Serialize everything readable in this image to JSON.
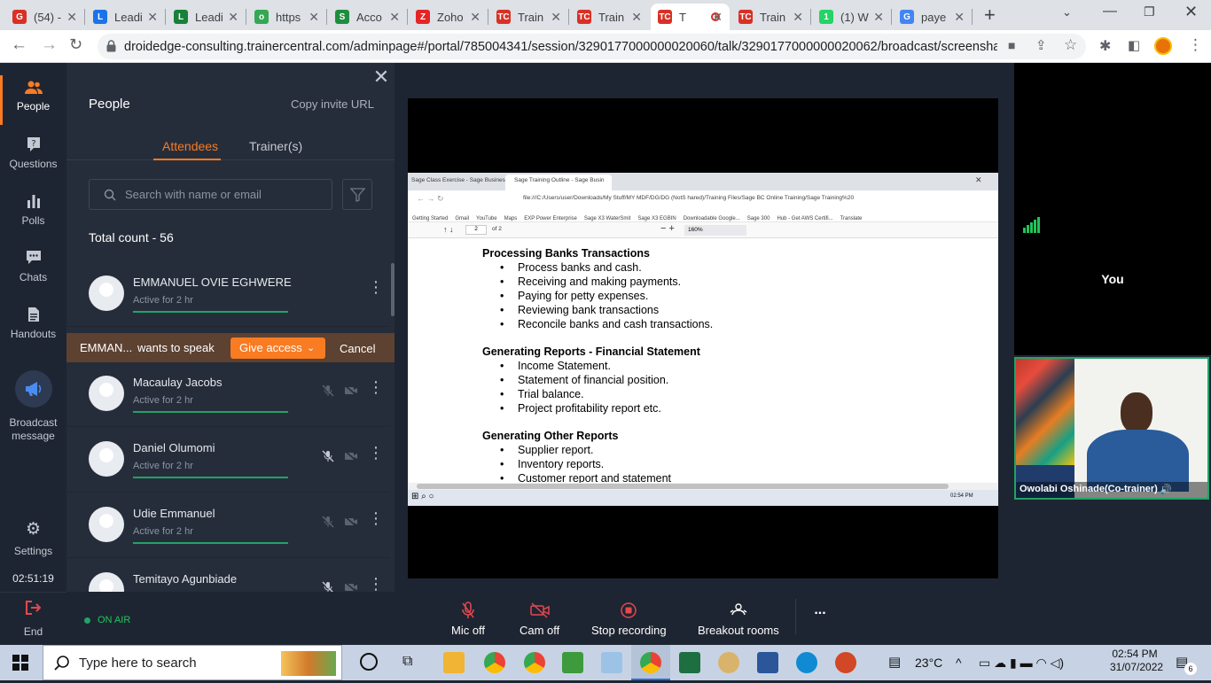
{
  "browser": {
    "tabs": [
      {
        "label": "(54) -",
        "color": "#d93025",
        "glyph": "G"
      },
      {
        "label": "Leadi",
        "color": "#1a73e8",
        "glyph": "L"
      },
      {
        "label": "Leadi",
        "color": "#188038",
        "glyph": "L"
      },
      {
        "label": "https",
        "color": "#34a853",
        "glyph": "o"
      },
      {
        "label": "Acco",
        "color": "#1e8e3e",
        "glyph": "S"
      },
      {
        "label": "Zoho",
        "color": "#e42527",
        "glyph": "Z"
      },
      {
        "label": "Train",
        "color": "#d93025",
        "glyph": "TC"
      },
      {
        "label": "Train",
        "color": "#d93025",
        "glyph": "TC"
      },
      {
        "label": "T",
        "color": "#d93025",
        "glyph": "TC"
      },
      {
        "label": "Train",
        "color": "#d93025",
        "glyph": "TC"
      },
      {
        "label": "(1) W",
        "color": "#25d366",
        "glyph": "1"
      },
      {
        "label": "paye",
        "color": "#4285f4",
        "glyph": "G"
      }
    ],
    "new_tab": "+",
    "url": "droidedge-consulting.trainercentral.com/adminpage#/portal/785004341/session/3290177000000020060/talk/3290177000000020062/broadcast/screenshare..."
  },
  "rail": {
    "items": [
      {
        "label": "People",
        "icon": "people-icon"
      },
      {
        "label": "Questions",
        "icon": "question-icon"
      },
      {
        "label": "Polls",
        "icon": "polls-icon"
      },
      {
        "label": "Chats",
        "icon": "chat-icon"
      },
      {
        "label": "Handouts",
        "icon": "handout-icon"
      },
      {
        "label": "Broadcast message",
        "icon": "megaphone-icon"
      }
    ],
    "settings": "Settings",
    "timer": "02:51:19",
    "end": "End"
  },
  "panel": {
    "title": "People",
    "copy_invite": "Copy invite URL",
    "tab_attendees": "Attendees",
    "tab_trainers": "Trainer(s)",
    "search_placeholder": "Search with name or email",
    "total": "Total count - 56",
    "speak_name": "EMMAN...",
    "speak_text": "wants to speak",
    "give_access": "Give access",
    "cancel": "Cancel",
    "attendees": [
      {
        "name": "EMMANUEL OVIE EGHWERE",
        "status": "Active for 2 hr"
      },
      {
        "name": "Macaulay Jacobs",
        "status": "Active for 2 hr"
      },
      {
        "name": "Daniel Olumomi",
        "status": "Active for 2 hr"
      },
      {
        "name": "Udie Emmanuel",
        "status": "Active for 2 hr"
      },
      {
        "name": "Temitayo Agunbiade",
        "status": ""
      }
    ]
  },
  "share": {
    "inner_tabs": [
      "Sage Class Exercise - Sage Business",
      "Sage Training Outline - Sage Busin"
    ],
    "inner_url": "file:///C:/Users/user/Downloads/My Stuff/MY MDF/DG/DG (NotS hared)/Training Files/Sage BC Online Training/Sage Training%20",
    "bookmarks": [
      "Getting Started",
      "Gmail",
      "YouTube",
      "Maps",
      "EXP Power Enterprise",
      "Sage X3 WaterSmit",
      "Sage X3 EGBIN",
      "Downloadable Google...",
      "Sage 300",
      "Hub - Get AWS Certifi...",
      "Translate"
    ],
    "page": "2",
    "page_of": "of 2",
    "zoom": "160%",
    "sections": [
      {
        "heading": "Processing Banks Transactions",
        "items": [
          "Process banks and cash.",
          "Receiving and making payments.",
          "Paying for petty expenses.",
          "Reviewing bank transactions",
          "Reconcile banks and cash transactions."
        ]
      },
      {
        "heading": "Generating Reports - Financial Statement",
        "items": [
          "Income Statement.",
          "Statement of financial position.",
          "Trial balance.",
          "Project profitability report etc."
        ]
      },
      {
        "heading": "Generating Other Reports",
        "items": [
          "Supplier report.",
          "Inventory reports.",
          "Customer report and statement"
        ]
      }
    ],
    "inner_clock": "02:54 PM"
  },
  "videos": {
    "you": "You",
    "cotrainer": "Owolabi Oshinade(Co-trainer)"
  },
  "controls": {
    "on_air": "ON AIR",
    "mic": "Mic off",
    "cam": "Cam off",
    "record": "Stop recording",
    "breakout": "Breakout rooms",
    "more": "..."
  },
  "taskbar": {
    "search": "Type here to search",
    "temp": "23°C",
    "time": "02:54 PM",
    "date": "31/07/2022",
    "notif": "6"
  },
  "colors": {
    "accent": "#f97b22",
    "green": "#21a366",
    "panel": "#262d3a"
  }
}
